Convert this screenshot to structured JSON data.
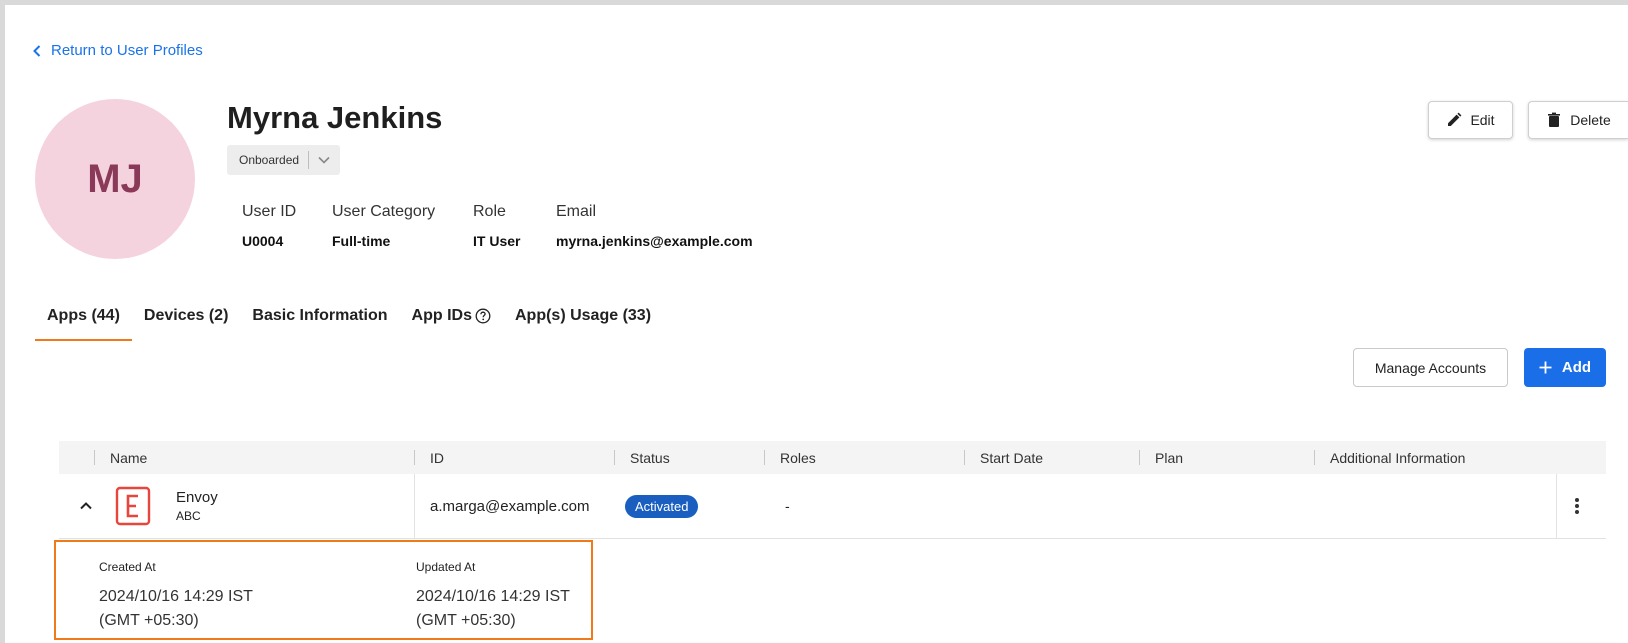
{
  "back_link": {
    "label": "Return to User Profiles"
  },
  "user": {
    "initials": "MJ",
    "name": "Myrna Jenkins",
    "status": "Onboarded",
    "fields": [
      {
        "label": "User ID",
        "value": "U0004"
      },
      {
        "label": "User Category",
        "value": "Full-time"
      },
      {
        "label": "Role",
        "value": "IT User"
      },
      {
        "label": "Email",
        "value": "myrna.jenkins@example.com"
      }
    ]
  },
  "actions": {
    "edit_label": "Edit",
    "delete_label": "Delete"
  },
  "tabs": [
    {
      "label": "Apps (44)",
      "active": true
    },
    {
      "label": "Devices (2)"
    },
    {
      "label": "Basic Information"
    },
    {
      "label": "App IDs"
    },
    {
      "label": "App(s) Usage (33)"
    }
  ],
  "toolbar": {
    "manage_label": "Manage Accounts",
    "add_label": "Add"
  },
  "table": {
    "columns": [
      "Name",
      "ID",
      "Status",
      "Roles",
      "Start Date",
      "Plan",
      "Additional Information"
    ],
    "rows": [
      {
        "app_name": "Envoy",
        "app_sub": "ABC",
        "id": "a.marga@example.com",
        "status": "Activated",
        "roles": "-",
        "start_date": "",
        "plan": "",
        "additional_info": ""
      }
    ]
  },
  "detail": {
    "created_label": "Created At",
    "created_value": "2024/10/16 14:29 IST (GMT +05:30)",
    "updated_label": "Updated At",
    "updated_value": "2024/10/16 14:29 IST (GMT +05:30)"
  },
  "colors": {
    "accent": "#1a6fe8",
    "tab_underline": "#f07a1a",
    "avatar_bg": "#f5d3de",
    "avatar_text": "#8a3a58",
    "status_pill": "#1a5fc0",
    "highlight_border": "#f07a1a",
    "envoy_brand": "#e8453c"
  },
  "icons": {
    "back": "chevron-left-icon",
    "status_dropdown": "chevron-down-icon",
    "edit": "pencil-icon",
    "delete": "trash-icon",
    "app_ids_help": "help-circle-icon",
    "add": "plus-icon",
    "row_toggle": "chevron-up-icon",
    "row_menu": "more-vertical-icon",
    "app_logo": "envoy-logo-icon"
  }
}
